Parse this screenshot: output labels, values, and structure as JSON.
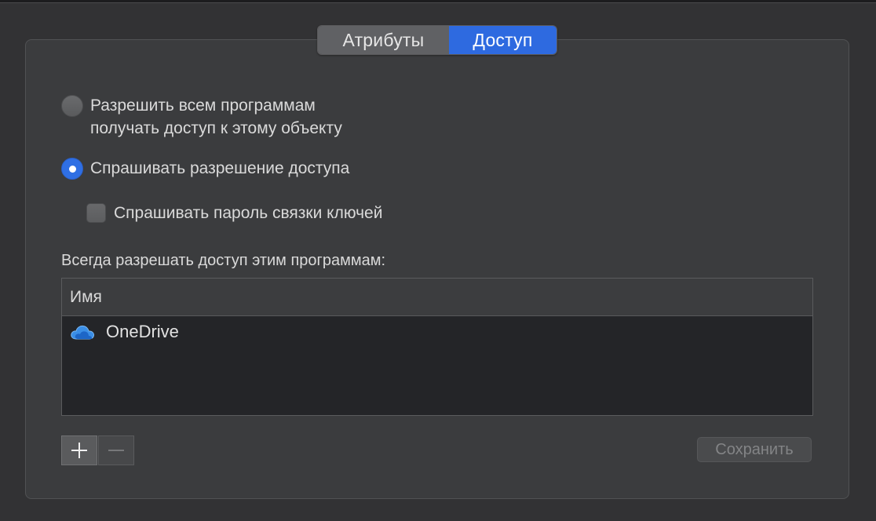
{
  "tabs": {
    "attributes_label": "Атрибуты",
    "access_label": "Доступ",
    "selected": "access"
  },
  "access_options": {
    "allow_all_line1": "Разрешить всем программам",
    "allow_all_line2": "получать доступ к этому объекту",
    "allow_all_selected": false,
    "ask_permission_label": "Спрашивать разрешение доступа",
    "ask_permission_selected": true,
    "ask_keychain_password_label": "Спрашивать пароль связки ключей",
    "ask_keychain_password_checked": false
  },
  "apps_list": {
    "heading": "Всегда разрешать доступ этим программам:",
    "column_name": "Имя",
    "items": [
      {
        "name": "OneDrive",
        "icon": "onedrive-cloud-icon"
      }
    ]
  },
  "buttons": {
    "add_label": "+",
    "remove_label": "—",
    "save_label": "Сохранить",
    "save_enabled": false
  },
  "colors": {
    "accent": "#2e6ae0",
    "panel_bg": "#3b3c3e",
    "list_bg": "#242528"
  }
}
